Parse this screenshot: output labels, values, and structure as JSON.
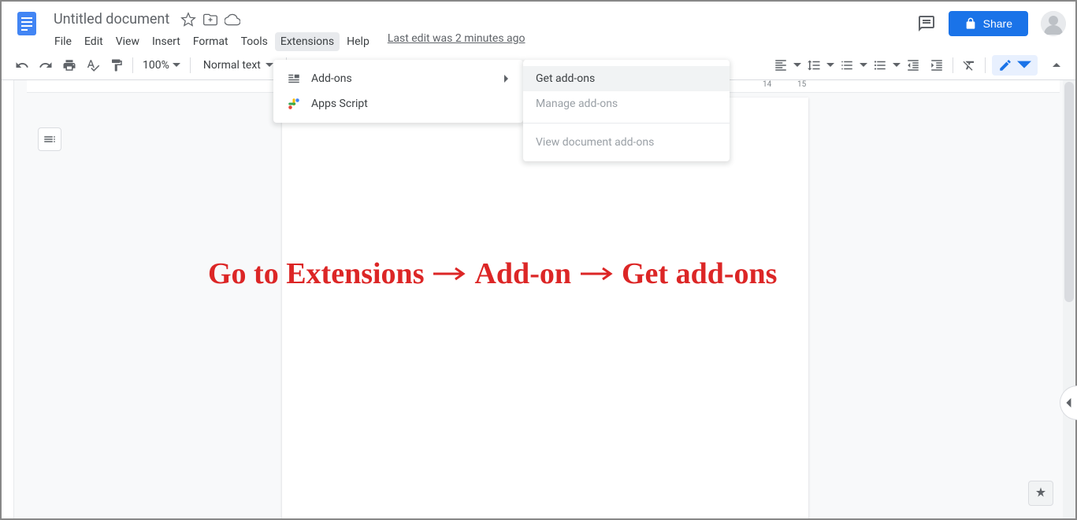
{
  "header": {
    "title": "Untitled document",
    "last_edit": "Last edit was 2 minutes ago",
    "share": "Share"
  },
  "menubar": [
    "File",
    "Edit",
    "View",
    "Insert",
    "Format",
    "Tools",
    "Extensions",
    "Help"
  ],
  "toolbar": {
    "zoom": "100%",
    "style": "Normal text"
  },
  "ext_menu": {
    "addons": "Add-ons",
    "apps_script": "Apps Script"
  },
  "sub_menu": {
    "get": "Get add-ons",
    "manage": "Manage add-ons",
    "view_doc": "View document add-ons"
  },
  "ruler_numbers": [
    "14",
    "15"
  ],
  "annotation": {
    "p1": "Go to Extensions",
    "p2": "Add-on",
    "p3": "Get add-ons"
  }
}
